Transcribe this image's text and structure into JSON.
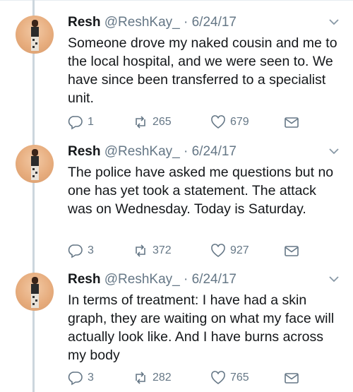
{
  "tweets": [
    {
      "name": "Resh",
      "handle": "@ReshKay_",
      "date": "6/24/17",
      "text": "Someone drove my naked cousin and me to the local hospital, and we were seen to. We have since been transferred to a specialist unit.",
      "replies": "1",
      "retweets": "265",
      "likes": "679"
    },
    {
      "name": "Resh",
      "handle": "@ReshKay_",
      "date": "6/24/17",
      "text": "The police have asked me questions but no one has yet took a statement. The attack was on Wednesday. Today is Saturday.",
      "replies": "3",
      "retweets": "372",
      "likes": "927"
    },
    {
      "name": "Resh",
      "handle": "@ReshKay_",
      "date": "6/24/17",
      "text": "In terms of treatment: I have had a skin graph, they are waiting on what my face will actually look like. And I have burns across my body",
      "replies": "3",
      "retweets": "282",
      "likes": "765"
    }
  ],
  "colors": {
    "text": "#14171a",
    "muted": "#657786",
    "thread": "#ccd6dd"
  },
  "icons": [
    "reply-icon",
    "retweet-icon",
    "like-icon",
    "message-icon",
    "chevron-down-icon"
  ]
}
